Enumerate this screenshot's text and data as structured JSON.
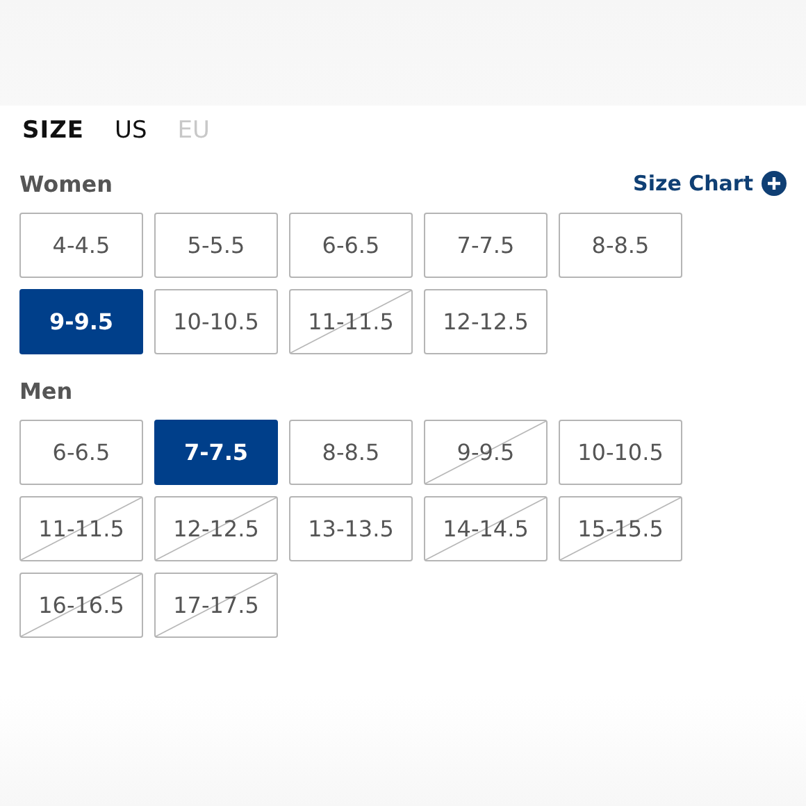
{
  "size_label": "SIZE",
  "units": [
    {
      "label": "US",
      "selected": true
    },
    {
      "label": "EU",
      "selected": false
    }
  ],
  "size_chart": {
    "label": "Size Chart"
  },
  "groups": [
    {
      "title": "Women",
      "sizes": [
        {
          "label": "4-4.5",
          "selected": false,
          "available": true
        },
        {
          "label": "5-5.5",
          "selected": false,
          "available": true
        },
        {
          "label": "6-6.5",
          "selected": false,
          "available": true
        },
        {
          "label": "7-7.5",
          "selected": false,
          "available": true
        },
        {
          "label": "8-8.5",
          "selected": false,
          "available": true
        },
        {
          "label": "9-9.5",
          "selected": true,
          "available": true
        },
        {
          "label": "10-10.5",
          "selected": false,
          "available": true
        },
        {
          "label": "11-11.5",
          "selected": false,
          "available": false
        },
        {
          "label": "12-12.5",
          "selected": false,
          "available": true
        }
      ]
    },
    {
      "title": "Men",
      "sizes": [
        {
          "label": "6-6.5",
          "selected": false,
          "available": true
        },
        {
          "label": "7-7.5",
          "selected": true,
          "available": true
        },
        {
          "label": "8-8.5",
          "selected": false,
          "available": true
        },
        {
          "label": "9-9.5",
          "selected": false,
          "available": false
        },
        {
          "label": "10-10.5",
          "selected": false,
          "available": true
        },
        {
          "label": "11-11.5",
          "selected": false,
          "available": false
        },
        {
          "label": "12-12.5",
          "selected": false,
          "available": false
        },
        {
          "label": "13-13.5",
          "selected": false,
          "available": true
        },
        {
          "label": "14-14.5",
          "selected": false,
          "available": false
        },
        {
          "label": "15-15.5",
          "selected": false,
          "available": false
        },
        {
          "label": "16-16.5",
          "selected": false,
          "available": false
        },
        {
          "label": "17-17.5",
          "selected": false,
          "available": false
        }
      ]
    }
  ]
}
